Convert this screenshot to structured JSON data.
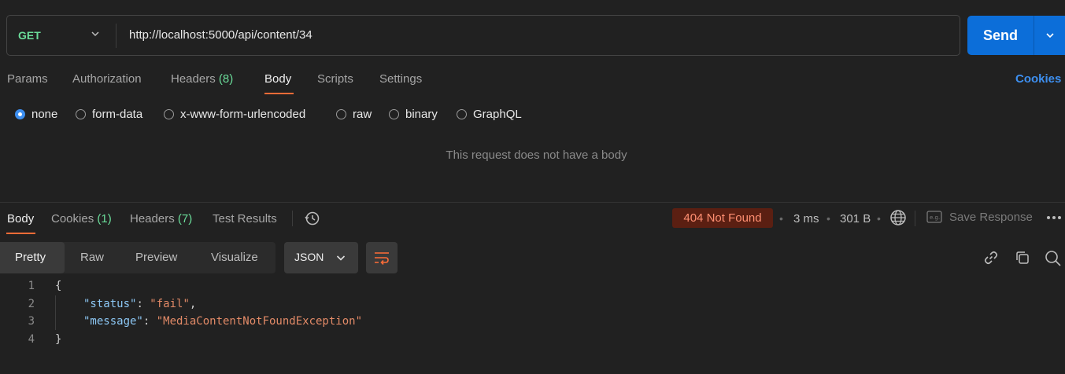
{
  "request": {
    "method": "GET",
    "url": "http://localhost:5000/api/content/34",
    "send_label": "Send"
  },
  "request_tabs": [
    {
      "label": "Params"
    },
    {
      "label": "Authorization"
    },
    {
      "label": "Headers",
      "count": "(8)"
    },
    {
      "label": "Body",
      "active": true
    },
    {
      "label": "Scripts"
    },
    {
      "label": "Settings"
    }
  ],
  "cookies_link": "Cookies",
  "body_types": [
    {
      "label": "none",
      "checked": true
    },
    {
      "label": "form-data"
    },
    {
      "label": "x-www-form-urlencoded"
    },
    {
      "label": "raw"
    },
    {
      "label": "binary"
    },
    {
      "label": "GraphQL"
    }
  ],
  "empty_body_message": "This request does not have a body",
  "response": {
    "tabs": [
      {
        "label": "Body",
        "active": true
      },
      {
        "label": "Cookies",
        "count": "(1)"
      },
      {
        "label": "Headers",
        "count": "(7)"
      },
      {
        "label": "Test Results"
      }
    ],
    "status": "404 Not Found",
    "time": "3 ms",
    "size": "301 B",
    "save_label": "Save Response",
    "view_modes": [
      {
        "label": "Pretty",
        "active": true
      },
      {
        "label": "Raw"
      },
      {
        "label": "Preview"
      },
      {
        "label": "Visualize"
      }
    ],
    "format": "JSON",
    "code_lines": [
      {
        "n": "1",
        "open": "{"
      },
      {
        "n": "2",
        "key": "\"status\"",
        "sep": ": ",
        "value": "\"fail\"",
        "trail": ","
      },
      {
        "n": "3",
        "key": "\"message\"",
        "sep": ": ",
        "value": "\"MediaContentNotFoundException\"",
        "trail": ""
      },
      {
        "n": "4",
        "close": "}"
      }
    ]
  },
  "colors": {
    "accent_orange": "#ff6c37",
    "send_blue": "#0c6ed9",
    "method_green": "#6bdd9a",
    "status_error_bg": "#5b1f12",
    "status_error_text": "#ff8f72"
  }
}
